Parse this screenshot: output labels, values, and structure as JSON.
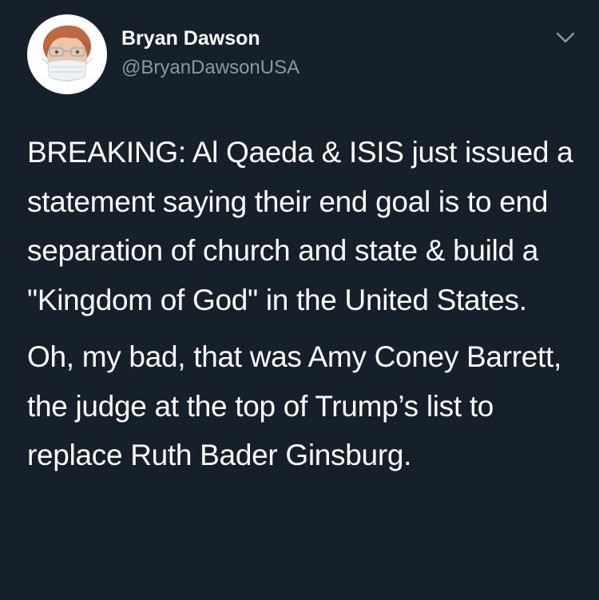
{
  "author": {
    "name": "Bryan Dawson",
    "handle": "@BryanDawsonUSA"
  },
  "menu_icon": "chevron-down-icon",
  "tweet": {
    "paragraphs": [
      "BREAKING: Al Qaeda & ISIS just issued a statement saying their end goal is to end separation of church and state & build a \"Kingdom of God\" in the United States.",
      "Oh, my bad, that was Amy Coney Barrett, the judge at the top of Trump’s list to replace Ruth Bader Ginsburg."
    ]
  },
  "colors": {
    "background": "#15202b",
    "text": "#ffffff",
    "secondary_text": "#8899a6"
  }
}
